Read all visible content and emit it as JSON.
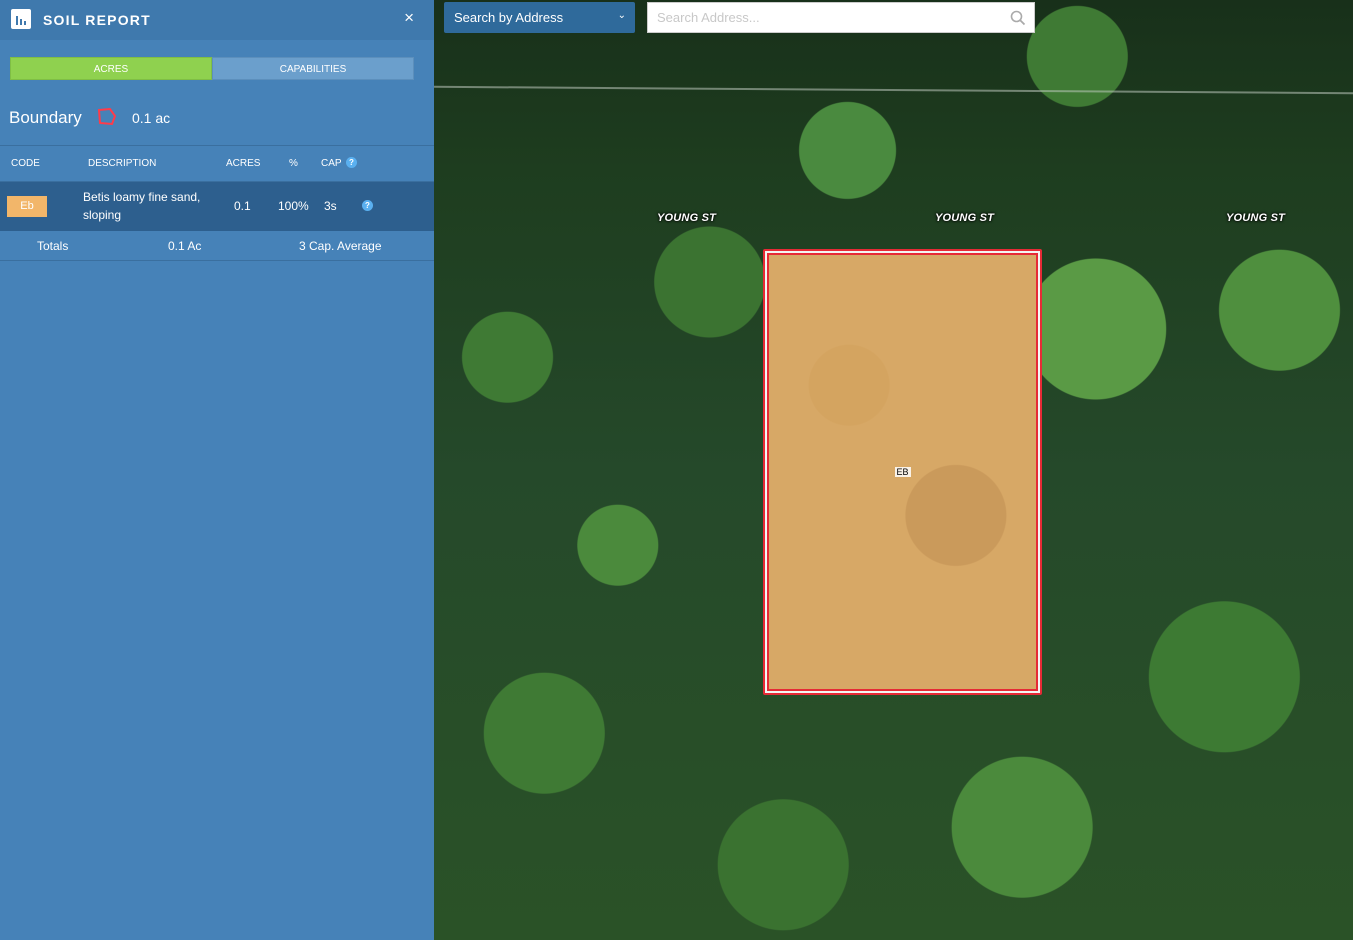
{
  "panel": {
    "title": "SOIL REPORT",
    "close_icon": "×",
    "tabs": [
      {
        "label": "ACRES",
        "active": true
      },
      {
        "label": "CAPABILITIES",
        "active": false
      }
    ],
    "boundary": {
      "label": "Boundary",
      "value": "0.1 ac"
    },
    "table": {
      "headers": {
        "code": "CODE",
        "description": "DESCRIPTION",
        "acres": "ACRES",
        "percent": "%",
        "cap": "CAP"
      },
      "rows": [
        {
          "code": "Eb",
          "description": "Betis loamy fine sand, sloping",
          "acres": "0.1",
          "percent": "100%",
          "cap": "3s",
          "color": "#f2b66a"
        }
      ],
      "totals": {
        "label": "Totals",
        "acres": "0.1 Ac",
        "cap": "3 Cap. Average"
      }
    }
  },
  "search": {
    "mode_label": "Search by Address",
    "placeholder": "Search Address..."
  },
  "map": {
    "street_labels": [
      "YOUNG ST",
      "YOUNG ST",
      "YOUNG ST"
    ],
    "parcel_soil_label": "EB"
  },
  "colors": {
    "panel": "#4682b8",
    "active_tab": "#8fd14f",
    "parcel_border": "#e62a36",
    "soil_fill": "#d7a866"
  }
}
